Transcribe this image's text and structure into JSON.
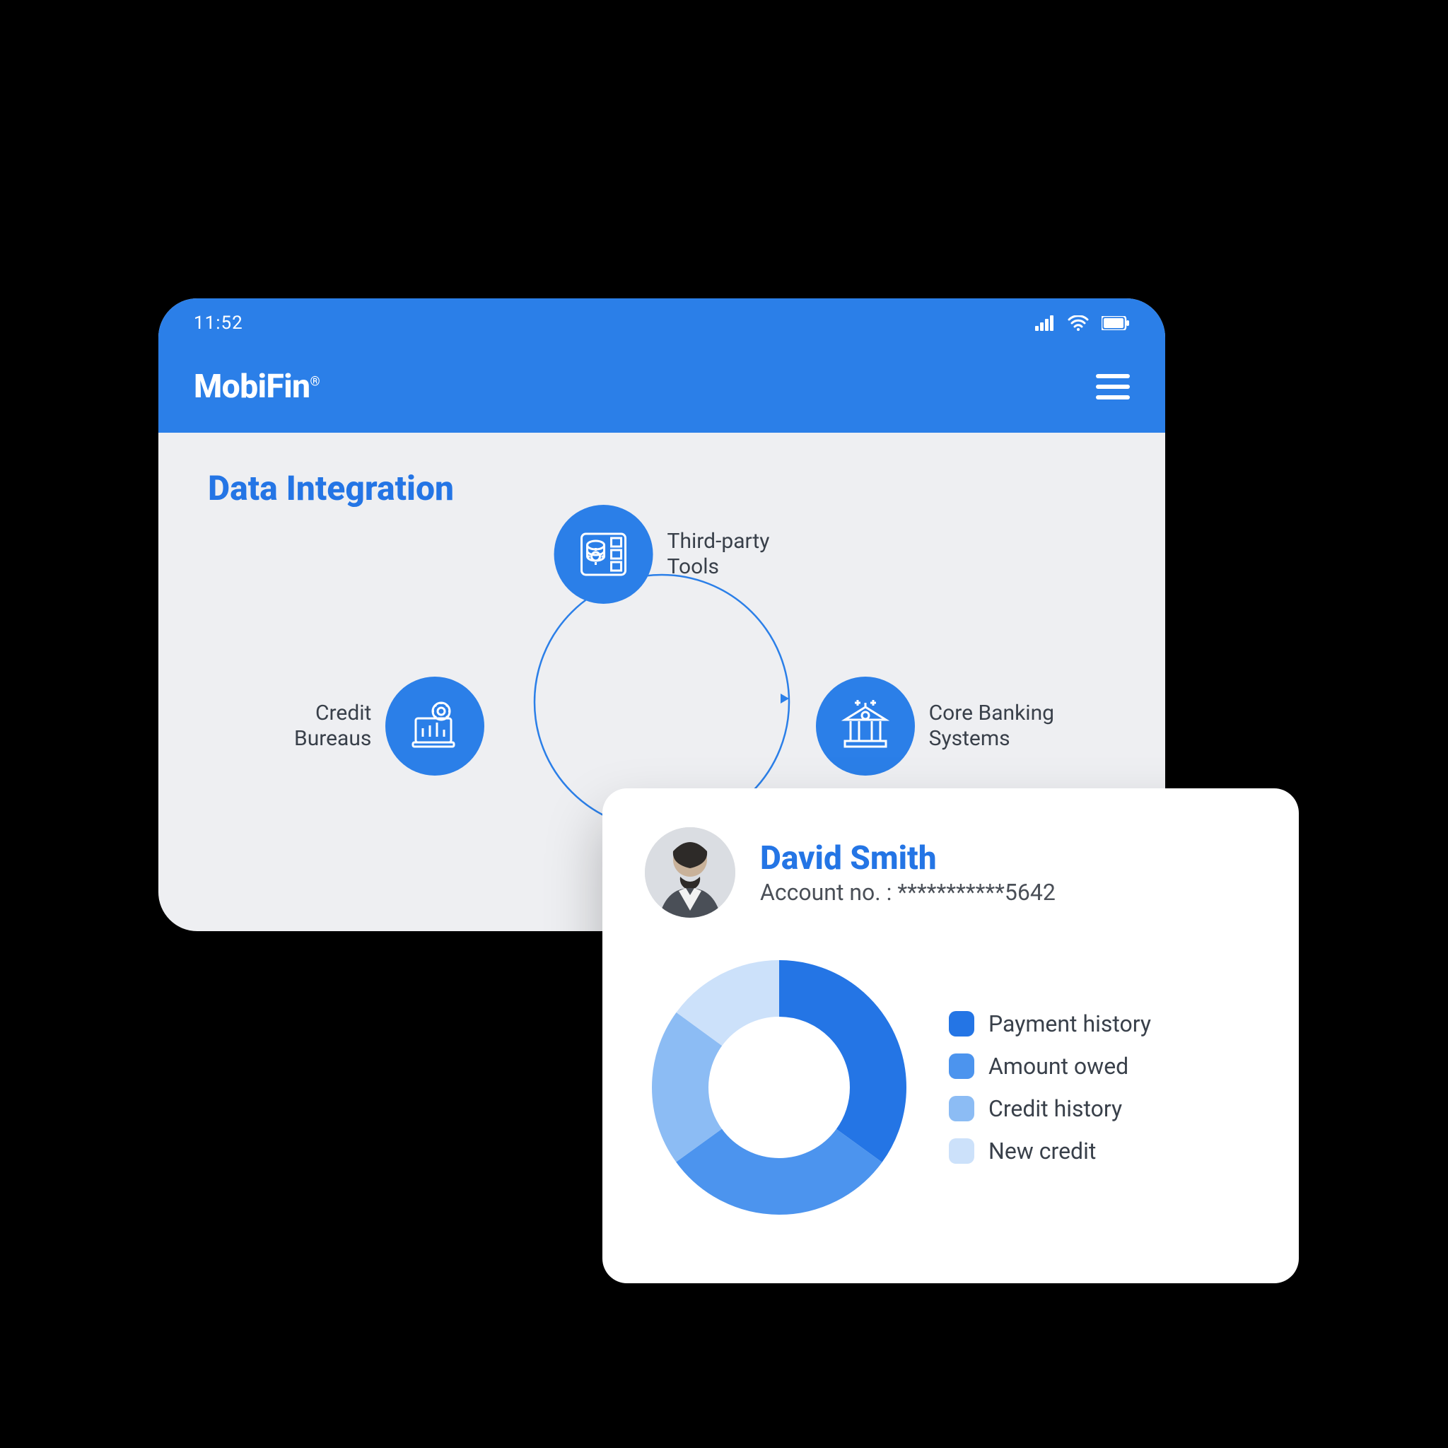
{
  "colors": {
    "brand_blue": "#2B7FE8",
    "title_blue": "#2475E5",
    "text": "#39404A",
    "bg_panel": "#EEEFF2"
  },
  "statusbar": {
    "time": "11:52"
  },
  "appbar": {
    "brand": "MobiFin"
  },
  "page": {
    "title": "Data Integration",
    "nodes": {
      "top": {
        "label": "Third-party\nTools"
      },
      "right": {
        "label": "Core Banking\nSystems"
      },
      "left": {
        "label": "Credit\nBureaus"
      }
    }
  },
  "usercard": {
    "name": "David Smith",
    "account_label": "Account no. :",
    "account_masked": "***********5642"
  },
  "chart_data": {
    "type": "pie",
    "title": "",
    "series": [
      {
        "name": "Payment history",
        "value": 35,
        "color": "#2475E5"
      },
      {
        "name": "Amount owed",
        "value": 30,
        "color": "#4C94EE"
      },
      {
        "name": "Credit history",
        "value": 20,
        "color": "#8CBCF4"
      },
      {
        "name": "New credit",
        "value": 15,
        "color": "#CCE1FA"
      }
    ]
  }
}
